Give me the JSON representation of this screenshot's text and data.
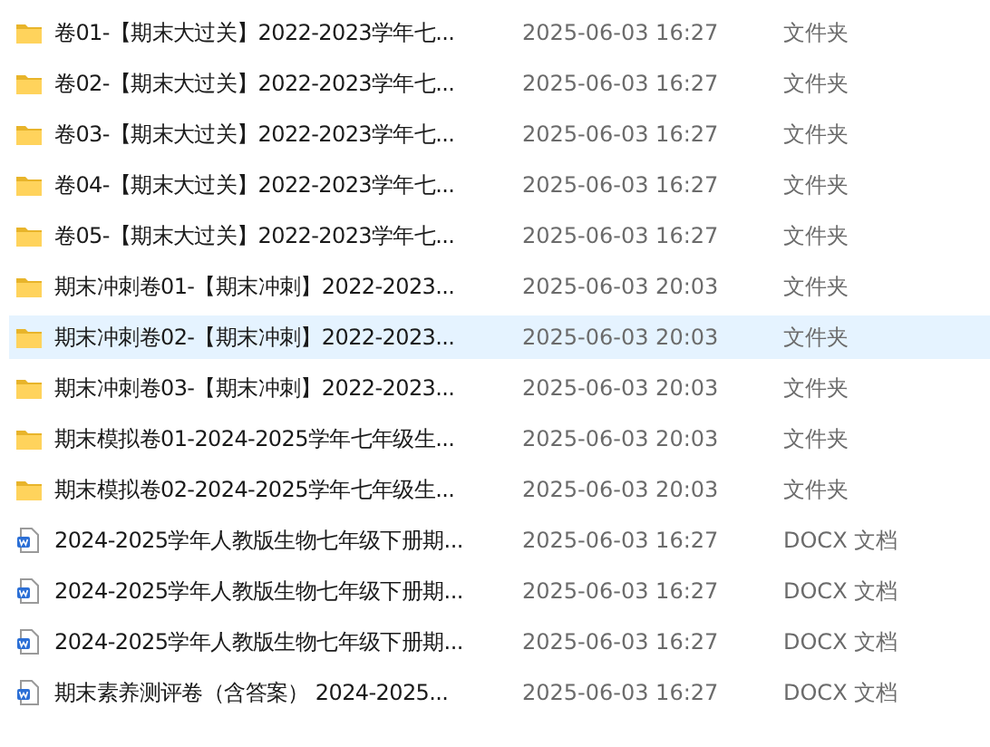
{
  "files": [
    {
      "kind": "folder",
      "name": "卷01-【期末大过关】2022-2023学年七...",
      "modified": "2025-06-03 16:27",
      "type": "文件夹",
      "selected": false
    },
    {
      "kind": "folder",
      "name": "卷02-【期末大过关】2022-2023学年七...",
      "modified": "2025-06-03 16:27",
      "type": "文件夹",
      "selected": false
    },
    {
      "kind": "folder",
      "name": "卷03-【期末大过关】2022-2023学年七...",
      "modified": "2025-06-03 16:27",
      "type": "文件夹",
      "selected": false
    },
    {
      "kind": "folder",
      "name": "卷04-【期末大过关】2022-2023学年七...",
      "modified": "2025-06-03 16:27",
      "type": "文件夹",
      "selected": false
    },
    {
      "kind": "folder",
      "name": "卷05-【期末大过关】2022-2023学年七...",
      "modified": "2025-06-03 16:27",
      "type": "文件夹",
      "selected": false
    },
    {
      "kind": "folder",
      "name": "期末冲刺卷01-【期末冲刺】2022-2023...",
      "modified": "2025-06-03 20:03",
      "type": "文件夹",
      "selected": false
    },
    {
      "kind": "folder",
      "name": "期末冲刺卷02-【期末冲刺】2022-2023...",
      "modified": "2025-06-03 20:03",
      "type": "文件夹",
      "selected": true
    },
    {
      "kind": "folder",
      "name": "期末冲刺卷03-【期末冲刺】2022-2023...",
      "modified": "2025-06-03 20:03",
      "type": "文件夹",
      "selected": false
    },
    {
      "kind": "folder",
      "name": "期末模拟卷01-2024-2025学年七年级生...",
      "modified": "2025-06-03 20:03",
      "type": "文件夹",
      "selected": false
    },
    {
      "kind": "folder",
      "name": "期末模拟卷02-2024-2025学年七年级生...",
      "modified": "2025-06-03 20:03",
      "type": "文件夹",
      "selected": false
    },
    {
      "kind": "docx",
      "name": "2024-2025学年人教版生物七年级下册期...",
      "modified": "2025-06-03 16:27",
      "type": "DOCX 文档",
      "selected": false
    },
    {
      "kind": "docx",
      "name": "2024-2025学年人教版生物七年级下册期...",
      "modified": "2025-06-03 16:27",
      "type": "DOCX 文档",
      "selected": false
    },
    {
      "kind": "docx",
      "name": "2024-2025学年人教版生物七年级下册期...",
      "modified": "2025-06-03 16:27",
      "type": "DOCX 文档",
      "selected": false
    },
    {
      "kind": "docx",
      "name": "期末素养测评卷（含答案） 2024-2025...",
      "modified": "2025-06-03 16:27",
      "type": "DOCX 文档",
      "selected": false
    }
  ]
}
